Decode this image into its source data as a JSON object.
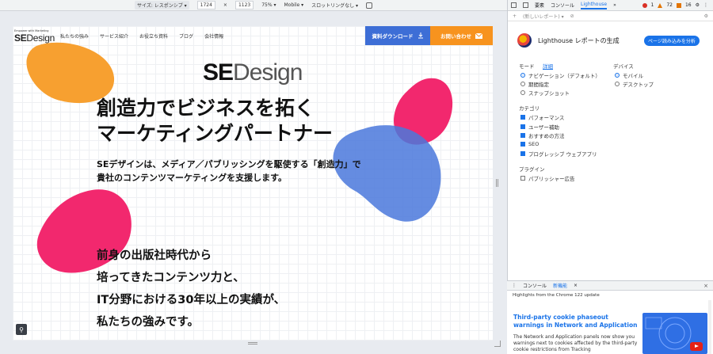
{
  "device_toolbar": {
    "dimensions_label": "サイズ: レスポンシブ ▾",
    "width": "1724",
    "times": "×",
    "height": "1123",
    "zoom": "75% ▾",
    "device_type": "Mobile ▾",
    "throttling": "スロットリングなし ▾"
  },
  "site": {
    "logo_tagline": "Empower with Marketing",
    "logo_bold": "SE",
    "logo_rest": "Design",
    "nav": [
      "私たちの強み",
      "サービス紹介",
      "お役立ち資料",
      "ブログ",
      "会社情報"
    ],
    "download_button": "資料ダウンロード",
    "contact_button": "お問い合わせ",
    "brand_bold": "SE",
    "brand_rest": "Design",
    "hero_line1": "創造力でビジネスを拓く",
    "hero_line2": "マーケティングパートナー",
    "sub_line1": "SEデザインは、メディア／パブリッシングを駆使する「創造力」で",
    "sub_line2": "貴社のコンテンツマーケティングを支援します。",
    "story_line1": "前身の出版社時代から",
    "story_line2": "培ってきたコンテンツ力と、",
    "story_line3": "IT分野における30年以上の実績が、",
    "story_line4": "私たちの強みです。",
    "colors": {
      "orange": "#f7a030",
      "pink": "#f2286e",
      "blue": "#4a78dc",
      "download_bg": "#3d6ed6",
      "contact_bg": "#f7931e"
    }
  },
  "devtools": {
    "tabs": [
      "要素",
      "コンソール",
      "Lighthouse",
      "»"
    ],
    "counters": {
      "errors": "1",
      "warnings": "72",
      "issues": "16"
    },
    "report_placeholder": "(新しいレポート) ▾",
    "lighthouse_title": "Lighthouse レポートの生成",
    "analyze_button": "ページ読み込みを分析",
    "mode": {
      "heading": "モード",
      "details_link": "詳細",
      "options": [
        "ナビゲーション（デフォルト）",
        "期間指定",
        "スナップショット"
      ],
      "selected": "ナビゲーション（デフォルト）"
    },
    "device": {
      "heading": "デバイス",
      "options": [
        "モバイル",
        "デスクトップ"
      ],
      "selected": "モバイル"
    },
    "categories": {
      "heading": "カテゴリ",
      "items": [
        "パフォーマンス",
        "ユーザー補助",
        "おすすめの方法",
        "SEO",
        "プログレッシブ ウェブアプリ"
      ]
    },
    "plugins": {
      "heading": "プラグイン",
      "items": [
        "パブリッシャー広告"
      ]
    }
  },
  "drawer": {
    "tabs": [
      "コンソール",
      "新機能",
      "×"
    ],
    "highlights": "Highlights from the Chrome 122 update",
    "article_title": "Third-party cookie phaseout warnings in Network and Application",
    "article_body": "The Network and Application panels now show you warnings next to cookies affected by the third-party cookie restrictions from Tracking",
    "close": "×"
  }
}
